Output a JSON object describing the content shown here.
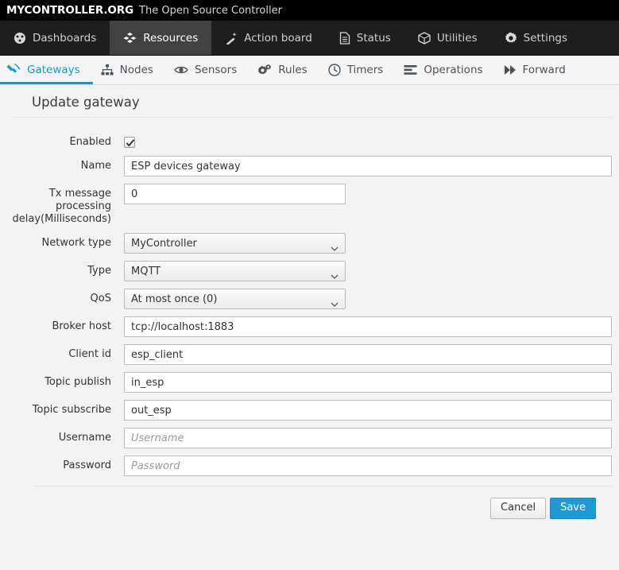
{
  "brand": {
    "name": "MYCONTROLLER.ORG",
    "tagline": "The Open Source Controller"
  },
  "colors": {
    "accent": "#0e9ad7",
    "primary_button": "#1e9ad3",
    "nav_background": "#1e1e1e",
    "nav_active_background": "#424242",
    "brandbar_background": "#030303",
    "page_background": "#f3f3f3"
  },
  "main_nav": {
    "items": [
      {
        "label": "Dashboards",
        "icon": "dashboard-icon",
        "active": false
      },
      {
        "label": "Resources",
        "icon": "resources-cubes-icon",
        "active": true
      },
      {
        "label": "Action board",
        "icon": "magic-wand-icon",
        "active": false
      },
      {
        "label": "Status",
        "icon": "document-icon",
        "active": false
      },
      {
        "label": "Utilities",
        "icon": "cube-icon",
        "active": false
      },
      {
        "label": "Settings",
        "icon": "gear-icon",
        "active": false
      }
    ]
  },
  "sub_nav": {
    "tabs": [
      {
        "label": "Gateways",
        "icon": "plug-icon",
        "active": true
      },
      {
        "label": "Nodes",
        "icon": "sitemap-icon",
        "active": false
      },
      {
        "label": "Sensors",
        "icon": "eye-icon",
        "active": false
      },
      {
        "label": "Rules",
        "icon": "gears-icon",
        "active": false
      },
      {
        "label": "Timers",
        "icon": "clock-icon",
        "active": false
      },
      {
        "label": "Operations",
        "icon": "list-icon",
        "active": false
      },
      {
        "label": "Forward",
        "icon": "forward-icon",
        "active": false
      }
    ]
  },
  "page": {
    "title": "Update gateway"
  },
  "form": {
    "enabled": {
      "label": "Enabled",
      "checked": true
    },
    "name": {
      "label": "Name",
      "value": "ESP devices gateway",
      "placeholder": ""
    },
    "tx_delay": {
      "label": "Tx message processing delay(Milliseconds)",
      "value": "0",
      "placeholder": ""
    },
    "network_type": {
      "label": "Network type",
      "value": "MyController"
    },
    "type": {
      "label": "Type",
      "value": "MQTT"
    },
    "qos": {
      "label": "QoS",
      "value": "At most once (0)"
    },
    "broker_host": {
      "label": "Broker host",
      "value": "tcp://localhost:1883",
      "placeholder": ""
    },
    "client_id": {
      "label": "Client id",
      "value": "esp_client",
      "placeholder": ""
    },
    "topic_publish": {
      "label": "Topic publish",
      "value": "in_esp",
      "placeholder": ""
    },
    "topic_subscribe": {
      "label": "Topic subscribe",
      "value": "out_esp",
      "placeholder": ""
    },
    "username": {
      "label": "Username",
      "value": "",
      "placeholder": "Username"
    },
    "password": {
      "label": "Password",
      "value": "",
      "placeholder": "Password"
    }
  },
  "footer": {
    "cancel_label": "Cancel",
    "save_label": "Save"
  }
}
